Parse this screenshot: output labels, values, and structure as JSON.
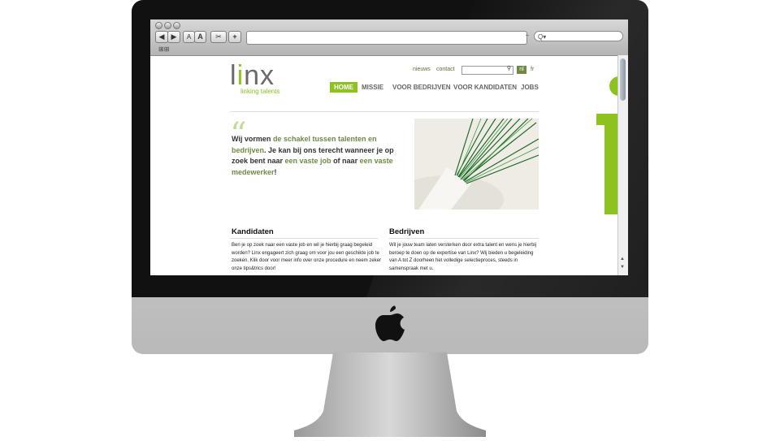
{
  "browser": {
    "back_label": "◀",
    "forward_label": "▶",
    "font_small_label": "A",
    "font_large_label": "A",
    "snippet_label": "✂",
    "add_label": "+",
    "url_value": "",
    "search_placeholder": "Q▾",
    "bookmark_label": "⊞⊞"
  },
  "site": {
    "logo_text": "linx",
    "logo_tagline": "linking talents",
    "toplinks": {
      "news": "nieuws",
      "contact": "contact"
    },
    "search_value": "",
    "lang": {
      "nl": "nl",
      "fr": "fr"
    },
    "nav": [
      {
        "label": "HOME",
        "active": true
      },
      {
        "label": "MISSIE"
      },
      {
        "label": "VOOR BEDRIJVEN"
      },
      {
        "label": "VOOR KANDIDATEN"
      },
      {
        "label": "JOBS"
      }
    ],
    "intro": {
      "p1": "Wij vormen ",
      "hl1": "de schakel tussen talenten en bedrijven",
      "p2": ". Je kan bij ons terecht wanneer je op zoek bent naar ",
      "hl2": "een vaste job",
      "p3": " of naar ",
      "hl3": "een vaste medewerker",
      "p4": "!"
    },
    "candidates": {
      "title": "Kandidaten",
      "text": "Ben je op zoek naar een vaste job en wil je hierbij graag begeleid worden? Linx engageert zich graag om voor jou een geschikte job te zoeken. Klik door voor meer info over onze procedure en neem zeker onze tips&trics door!"
    },
    "companies": {
      "title": "Bedrijven",
      "text": "Wil je jouw team laten versterken door extra talent en wens je hierbij beroep te doen op de expertise van Linx? Wij bieden u begeleiding van A tot Z doorheen het volledige selectieproces, steeds in samenspraak met u."
    }
  },
  "colors": {
    "brand_green": "#8dc21f",
    "dark_green": "#6f8a46",
    "bezel": "#111111"
  },
  "icons": [
    "apple-logo-icon",
    "search-icon",
    "scroll-up-icon",
    "scroll-down-icon"
  ]
}
